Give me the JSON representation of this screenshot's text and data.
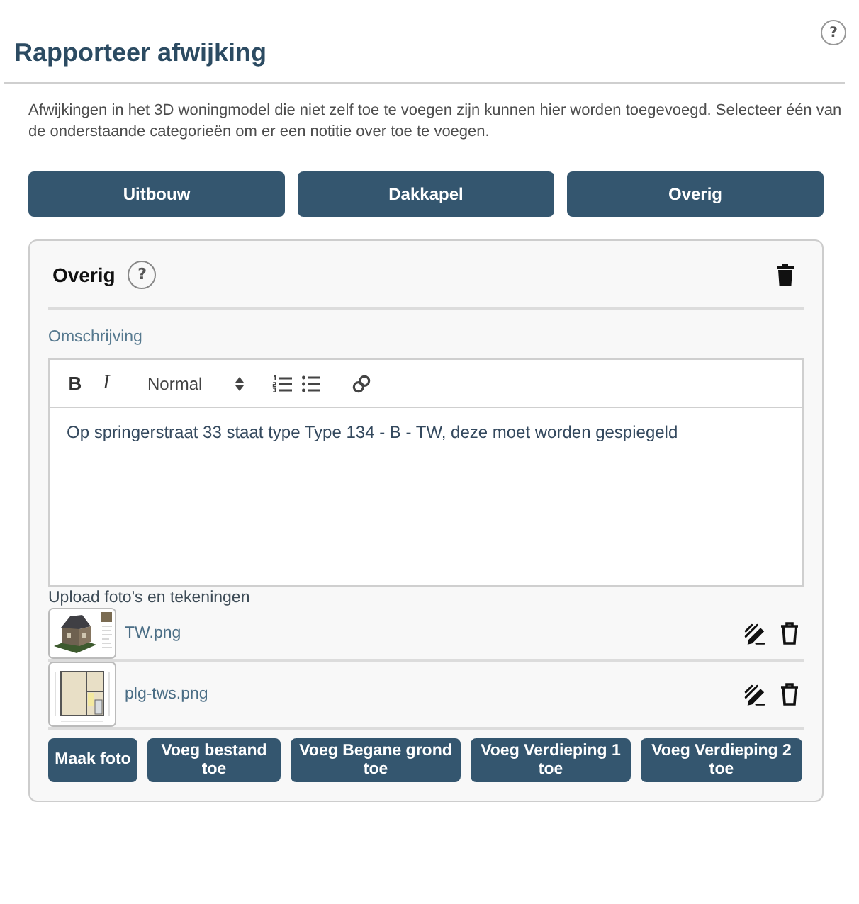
{
  "help": "?",
  "title": "Rapporteer afwijking",
  "intro": "Afwijkingen in het 3D woningmodel die niet zelf toe te voegen zijn kunnen hier worden toegevoegd. Selecteer één van de onderstaande categorieën om er een notitie over toe te voegen.",
  "categories": [
    "Uitbouw",
    "Dakkapel",
    "Overig"
  ],
  "card": {
    "title": "Overig",
    "help": "?",
    "description_label": "Omschrijving",
    "toolbar": [
      {
        "kind": "bold",
        "label": "B"
      },
      {
        "kind": "italic",
        "label": "I"
      },
      {
        "kind": "select",
        "label": "Normal"
      },
      {
        "kind": "ordered-list"
      },
      {
        "kind": "bullet-list"
      },
      {
        "kind": "link"
      }
    ],
    "description": "Op springerstraat 33 staat type Type 134 - B - TW, deze moet worden gespiegeld",
    "upload_label": "Upload foto's en tekeningen",
    "files": [
      {
        "name": "TW.png",
        "kind": "render"
      },
      {
        "name": "plg-tws.png",
        "kind": "plan"
      }
    ],
    "actions": [
      "Maak foto",
      "Voeg bestand toe",
      "Voeg Begane grond toe",
      "Voeg Verdieping 1 toe",
      "Voeg Verdieping 2 toe"
    ]
  }
}
